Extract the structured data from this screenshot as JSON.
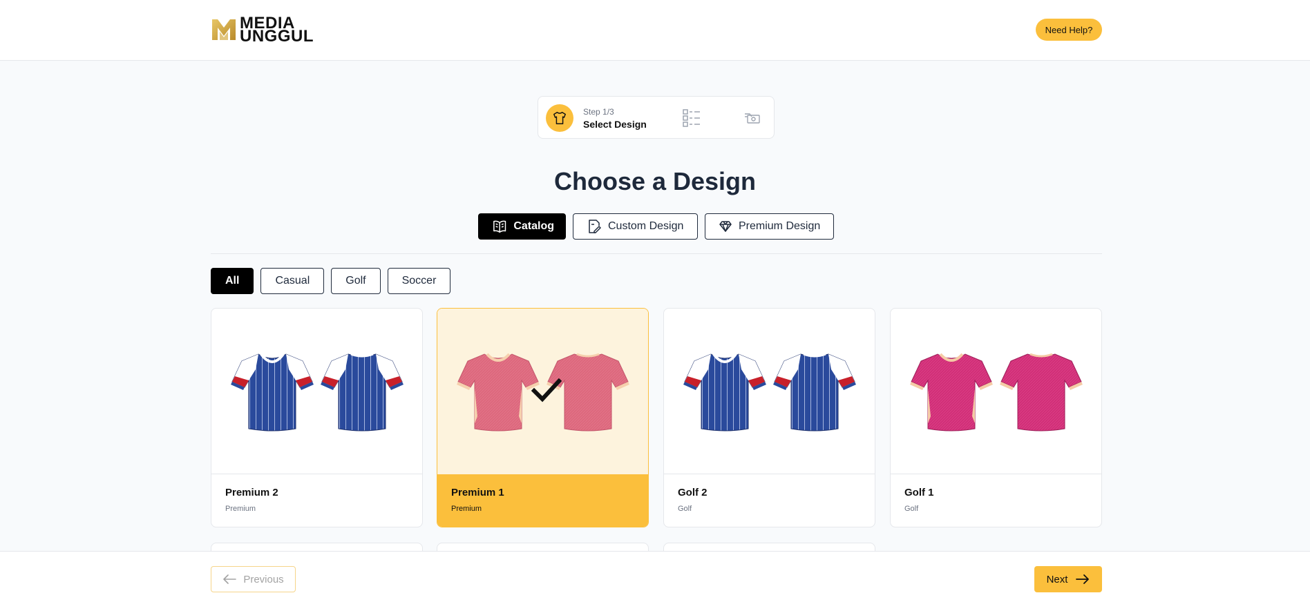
{
  "brand": {
    "line1": "MEDIA",
    "line2": "UNGGUL",
    "gold": "#c9a227"
  },
  "header": {
    "help_label": "Need Help?"
  },
  "stepper": {
    "step_number": "Step 1/3",
    "step_title": "Select Design",
    "accent": "#fbbf3c"
  },
  "page_title": "Choose a Design",
  "design_tabs": [
    {
      "label": "Catalog",
      "icon": "book-icon",
      "active": true
    },
    {
      "label": "Custom Design",
      "icon": "edit-document-icon",
      "active": false
    },
    {
      "label": "Premium Design",
      "icon": "diamond-icon",
      "active": false
    }
  ],
  "filters": [
    {
      "label": "All",
      "active": true
    },
    {
      "label": "Casual",
      "active": false
    },
    {
      "label": "Golf",
      "active": false
    },
    {
      "label": "Soccer",
      "active": false
    }
  ],
  "designs": [
    {
      "name": "Premium 2",
      "category": "Premium",
      "jersey": "blue-striped",
      "selected": false
    },
    {
      "name": "Premium 1",
      "category": "Premium",
      "jersey": "pink",
      "selected": true
    },
    {
      "name": "Golf 2",
      "category": "Golf",
      "jersey": "blue-striped",
      "selected": false
    },
    {
      "name": "Golf 1",
      "category": "Golf",
      "jersey": "magenta",
      "selected": false
    }
  ],
  "footer": {
    "previous_label": "Previous",
    "next_label": "Next"
  },
  "colors": {
    "accent": "#fbbf3c",
    "dark": "#1e293b",
    "jersey_blue": "#2a4a9c",
    "jersey_pink": "#d8506d",
    "jersey_magenta": "#d12f78"
  }
}
